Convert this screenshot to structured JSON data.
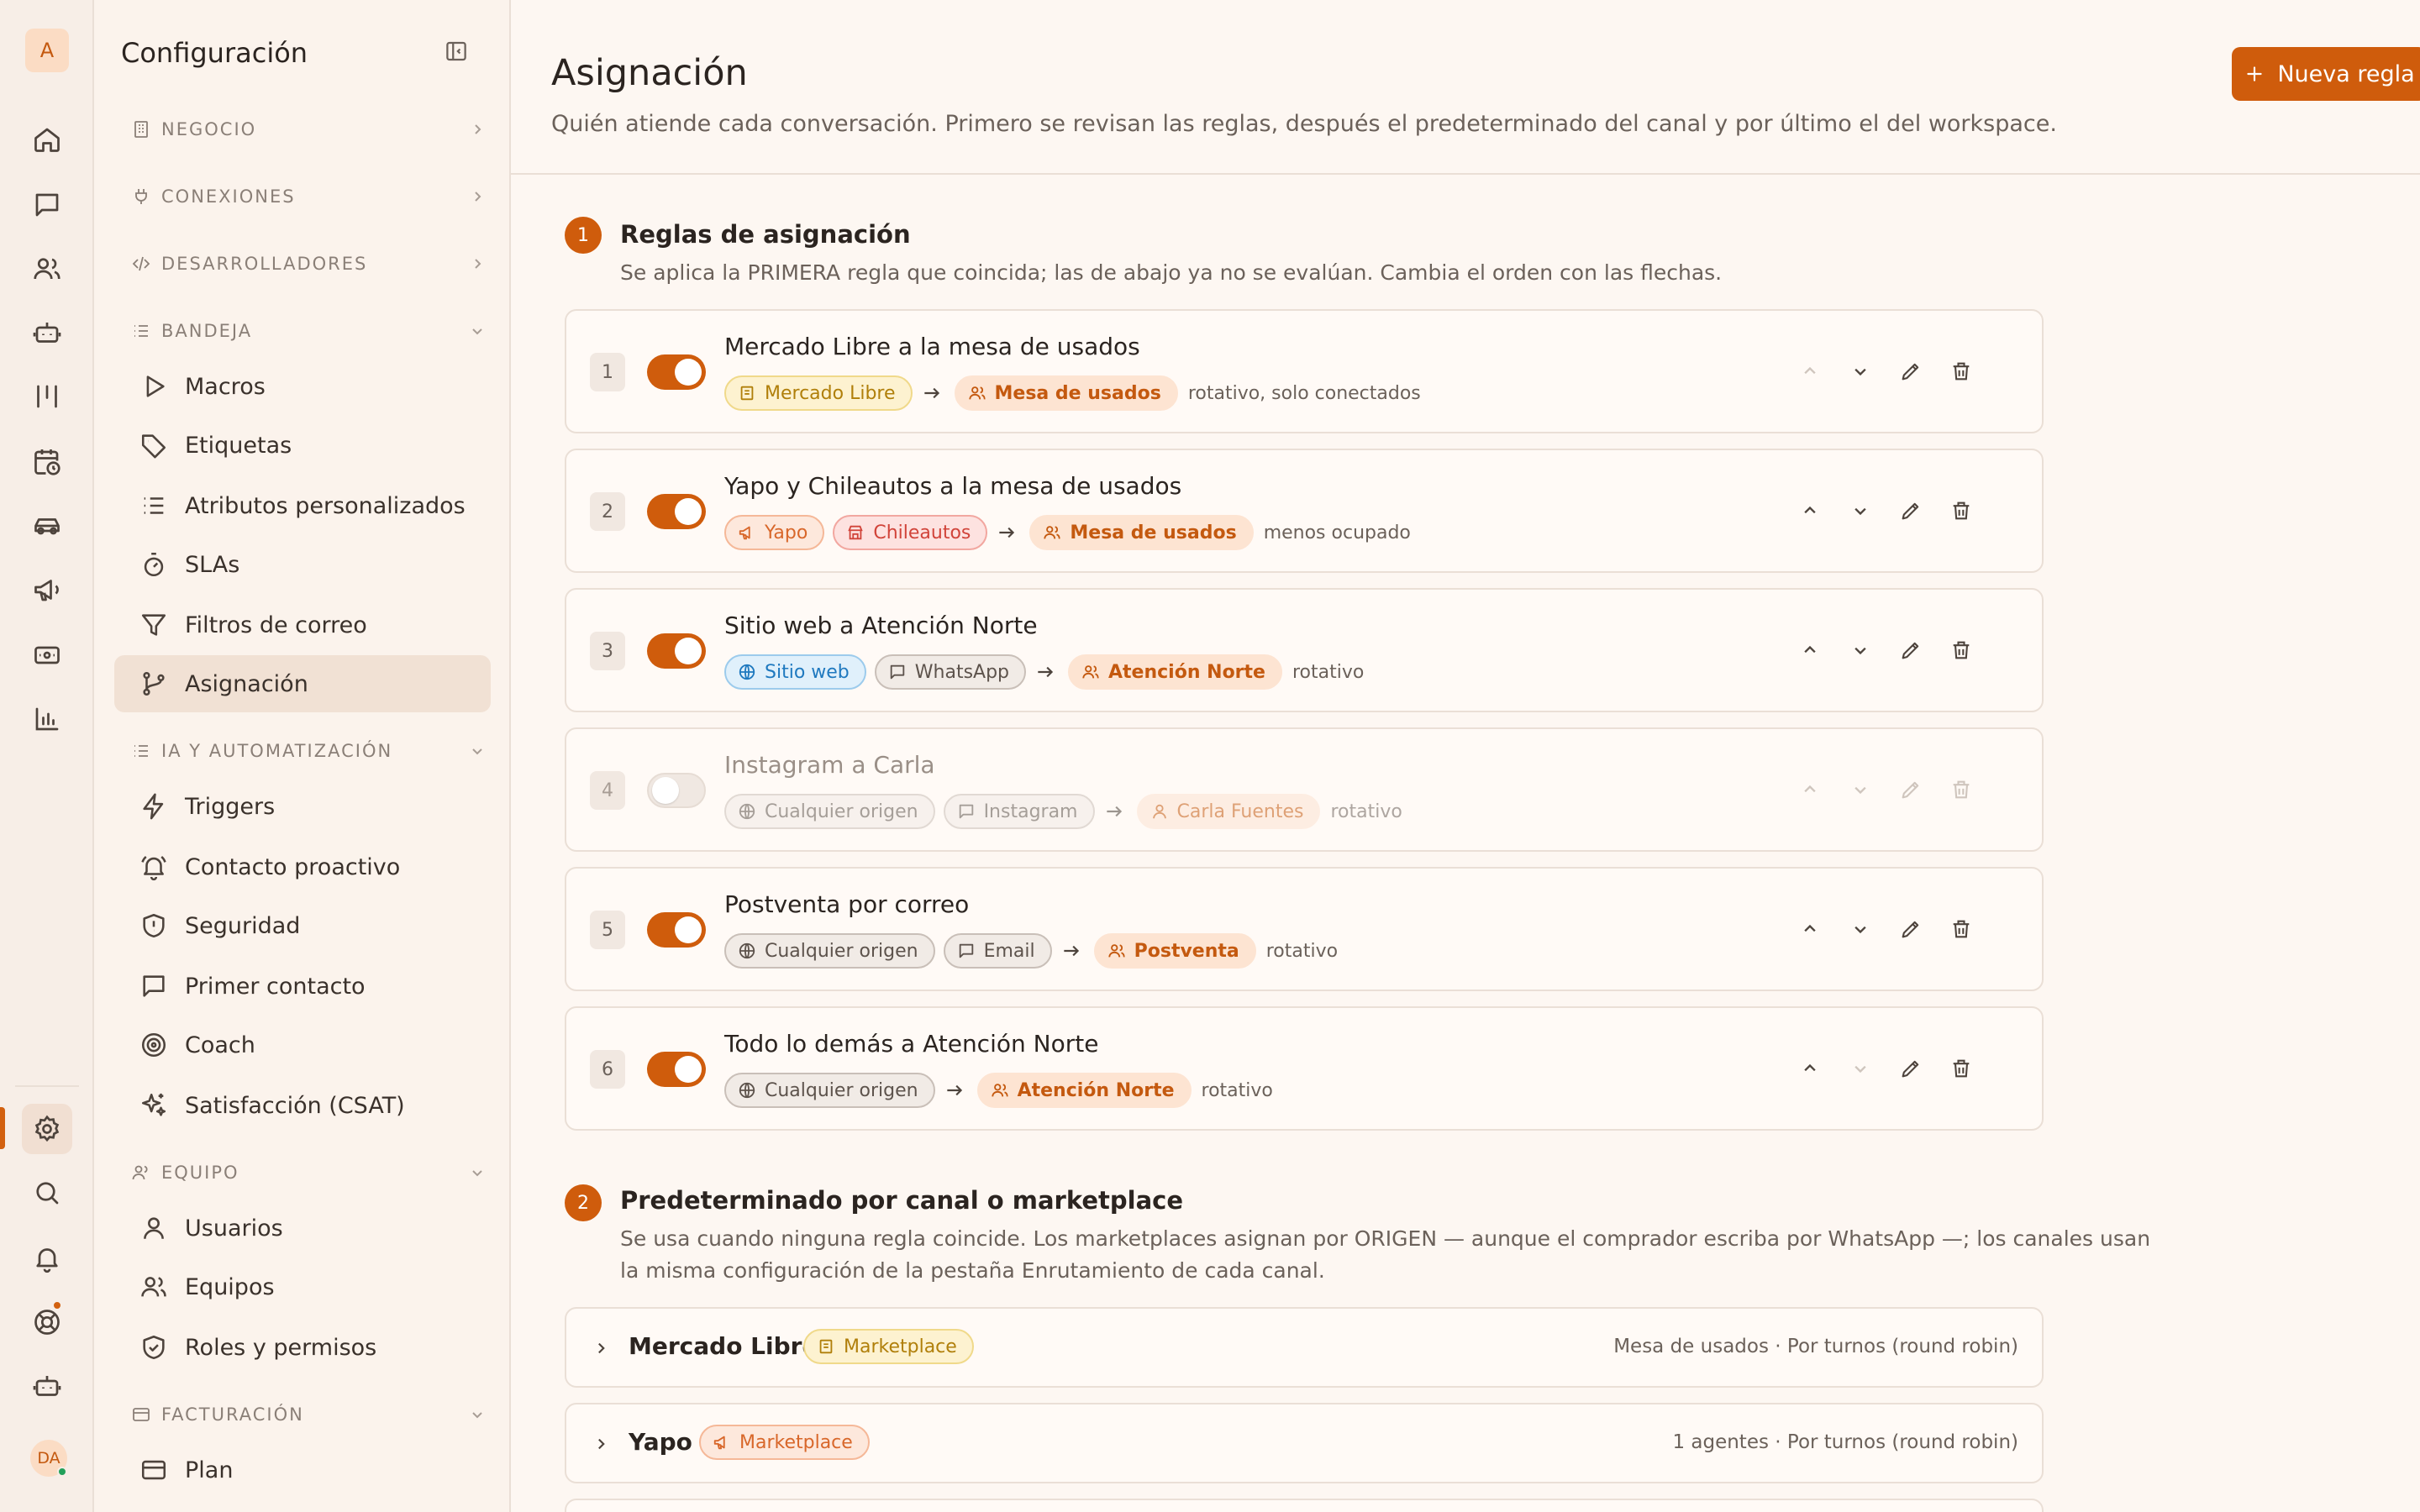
{
  "app": {
    "logo_letter": "A",
    "user_initials": "DA"
  },
  "sidebar": {
    "title": "Configuración",
    "sections": {
      "negocio": "NEGOCIO",
      "conexiones": "CONEXIONES",
      "desarrolladores": "DESARROLLADORES",
      "bandeja": "BANDEJA",
      "ia": "IA Y AUTOMATIZACIÓN",
      "equipo": "EQUIPO",
      "facturacion": "FACTURACIÓN"
    },
    "items": {
      "macros": "Macros",
      "etiquetas": "Etiquetas",
      "atributos": "Atributos personalizados",
      "slas": "SLAs",
      "filtros": "Filtros de correo",
      "asignacion": "Asignación",
      "triggers": "Triggers",
      "contacto": "Contacto proactivo",
      "seguridad": "Seguridad",
      "primer": "Primer contacto",
      "coach": "Coach",
      "csat": "Satisfacción (CSAT)",
      "usuarios": "Usuarios",
      "equipos": "Equipos",
      "roles": "Roles y permisos",
      "plan": "Plan"
    }
  },
  "header": {
    "title": "Asignación",
    "subtitle": "Quién atiende cada conversación. Primero se revisan las reglas, después el predeterminado del canal y por último el del workspace.",
    "new_button": "Nueva regla"
  },
  "section1": {
    "number": "1",
    "title": "Reglas de asignación",
    "subtitle": "Se aplica la PRIMERA regla que coincida; las de abajo ya no se evalúan. Cambia el orden con las flechas."
  },
  "rules": [
    {
      "n": "1",
      "name": "Mercado Libre a la mesa de usados",
      "sources": [
        "Mercado Libre"
      ],
      "team": "Mesa de usados",
      "strategy": "rotativo, solo conectados"
    },
    {
      "n": "2",
      "name": "Yapo y Chileautos a la mesa de usados",
      "sources": [
        "Yapo",
        "Chileautos"
      ],
      "team": "Mesa de usados",
      "strategy": "menos ocupado"
    },
    {
      "n": "3",
      "name": "Sitio web a Atención Norte",
      "sources": [
        "Sitio web",
        "WhatsApp"
      ],
      "team": "Atención Norte",
      "strategy": "rotativo"
    },
    {
      "n": "4",
      "name": "Instagram a Carla",
      "sources": [
        "Cualquier origen",
        "Instagram"
      ],
      "team": "Carla Fuentes",
      "strategy": "rotativo"
    },
    {
      "n": "5",
      "name": "Postventa por correo",
      "sources": [
        "Cualquier origen",
        "Email"
      ],
      "team": "Postventa",
      "strategy": "rotativo"
    },
    {
      "n": "6",
      "name": "Todo lo demás a Atención Norte",
      "sources": [
        "Cualquier origen"
      ],
      "team": "Atención Norte",
      "strategy": "rotativo"
    }
  ],
  "section2": {
    "number": "2",
    "title": "Predeterminado por canal o marketplace",
    "subtitle_line1": "Se usa cuando ninguna regla coincide. Los marketplaces asignan por ORIGEN — aunque el comprador escriba por WhatsApp —; los canales usan",
    "subtitle_line2": "la misma configuración de la pestaña Enrutamiento de cada canal."
  },
  "channels": [
    {
      "name": "Mercado Libre",
      "badge": "Marketplace",
      "info": "Mesa de usados · Por turnos (round robin)"
    },
    {
      "name": "Yapo",
      "badge": "Marketplace",
      "info": "1 agentes · Por turnos (round robin)"
    }
  ],
  "colors": {
    "accent": "#cf5c0c",
    "background": "#fdf7f2"
  }
}
